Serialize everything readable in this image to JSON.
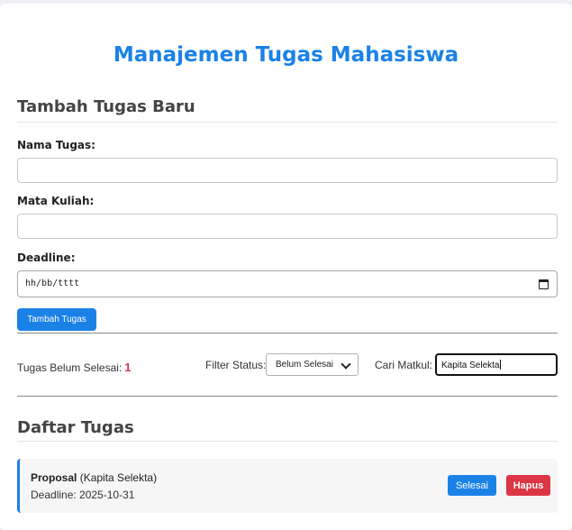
{
  "app": {
    "title": "Manajemen Tugas Mahasiswa"
  },
  "form": {
    "section_title": "Tambah Tugas Baru",
    "task_name_label": "Nama Tugas:",
    "task_name_value": "",
    "course_label": "Mata Kuliah:",
    "course_value": "",
    "deadline_label": "Deadline:",
    "deadline_placeholder": "hh/bb/tttt",
    "add_button_label": "Tambah Tugas"
  },
  "toolbar": {
    "pending_label": "Tugas Belum Selesai:",
    "pending_count": "1",
    "filter_label": "Filter Status:",
    "filter_selected": "Belum Selesai",
    "search_label": "Cari Matkul:",
    "search_value": "Kapita Selekta"
  },
  "list": {
    "section_title": "Daftar Tugas",
    "tasks": [
      {
        "name": "Proposal",
        "course": "(Kapita Selekta)",
        "deadline_text": "Deadline: 2025-10-31",
        "done_label": "Selesai",
        "delete_label": "Hapus"
      }
    ]
  },
  "colors": {
    "accent": "#1a82e6",
    "danger": "#dc3545"
  }
}
